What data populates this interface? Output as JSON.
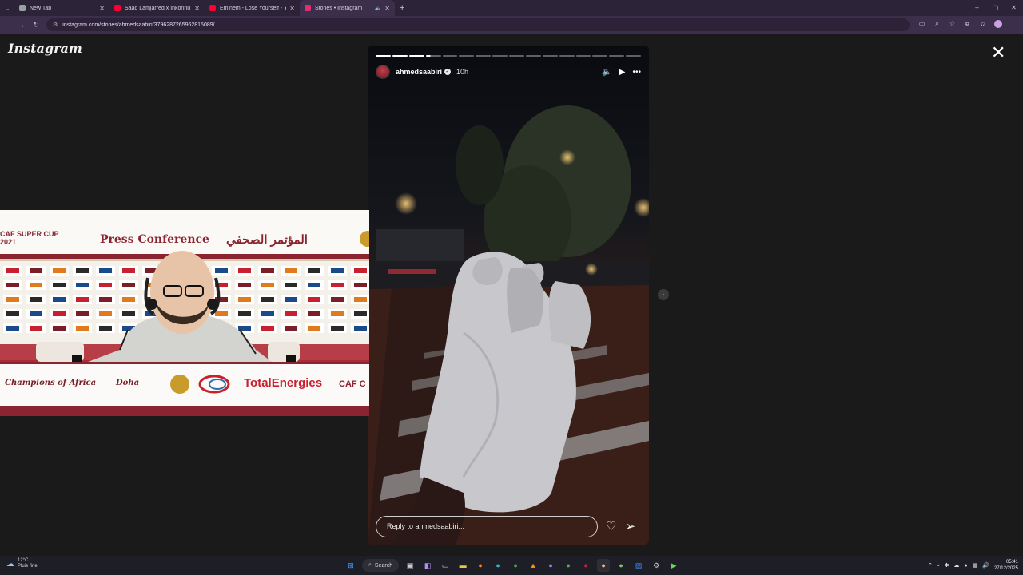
{
  "browser": {
    "tabs": [
      {
        "label": "New Tab",
        "favicon_color": "#9aa0a6",
        "active": false,
        "audio": false
      },
      {
        "label": "Saad Lamjarred x Inkonnu x Afri...",
        "favicon_color": "#ff0033",
        "active": false,
        "audio": false
      },
      {
        "label": "Eminem - Lose Yourself - YouTube",
        "favicon_color": "#ff0033",
        "active": false,
        "audio": false
      },
      {
        "label": "Stories • Instagram",
        "favicon_color": "#e1306c",
        "active": true,
        "audio": true
      }
    ],
    "url": "instagram.com/stories/ahmedsaabiri/3796287265962815089/"
  },
  "instagram": {
    "logo": "Instagram",
    "story": {
      "username": "ahmedsaabiri",
      "time_ago": "10h",
      "segments_total": 16,
      "segments_done": 3,
      "current_segment_progress": 0.3,
      "reply_placeholder": "Reply to ahmedsaabiri..."
    }
  },
  "pip": {
    "banner_left": "CAF SUPER CUP",
    "banner_year": "2021",
    "banner_title": "Press Conference",
    "banner_arabic": "المؤتمر الصحفي",
    "table_text_left": "Champions of Africa",
    "table_text_city": "Doha",
    "table_sponsor": "TotalEnergies",
    "table_right": "CAF C",
    "sponsor_logo_1": "QNB"
  },
  "taskbar": {
    "weather_temp": "12°C",
    "weather_desc": "Pluie fine",
    "search_label": "Search",
    "time": "05:41",
    "date": "27/12/2025"
  }
}
